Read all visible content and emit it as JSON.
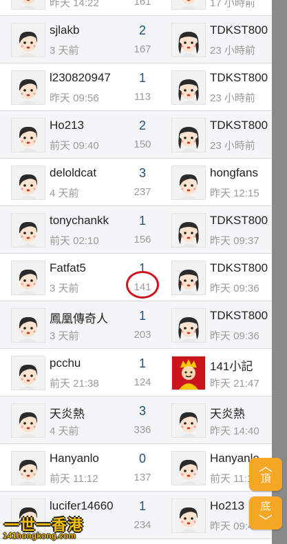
{
  "rows": [
    {
      "poster": "",
      "time": "昨天 14:22",
      "replies": "",
      "views": "161",
      "last_user": "",
      "last_time": "17 小時前",
      "last_avatar": "boy"
    },
    {
      "poster": "sjlakb",
      "time": "3 天前",
      "replies": "2",
      "views": "167",
      "last_user": "TDKST800",
      "last_time": "23 小時前",
      "last_avatar": "girl"
    },
    {
      "poster": "l230820947",
      "time": "昨天 09:56",
      "replies": "1",
      "views": "113",
      "last_user": "TDKST800",
      "last_time": "23 小時前",
      "last_avatar": "girl"
    },
    {
      "poster": "Ho213",
      "time": "前天 09:40",
      "replies": "2",
      "views": "150",
      "last_user": "TDKST800",
      "last_time": "23 小時前",
      "last_avatar": "girl"
    },
    {
      "poster": "deloldcat",
      "time": "4 天前",
      "replies": "3",
      "views": "237",
      "last_user": "hongfans",
      "last_time": "昨天 12:15",
      "last_avatar": "boy"
    },
    {
      "poster": "tonychankk",
      "time": "前天 02:10",
      "replies": "1",
      "views": "156",
      "last_user": "TDKST800",
      "last_time": "昨天 09:37",
      "last_avatar": "girl"
    },
    {
      "poster": "Fatfat5",
      "time": "3 天前",
      "replies": "1",
      "views": "141",
      "last_user": "TDKST800",
      "last_time": "昨天 09:36",
      "last_avatar": "girl"
    },
    {
      "poster": "鳳凰傳奇人",
      "time": "3 天前",
      "replies": "1",
      "views": "203",
      "last_user": "TDKST800",
      "last_time": "昨天 09:36",
      "last_avatar": "girl"
    },
    {
      "poster": "pcchu",
      "time": "前天 21:38",
      "replies": "1",
      "views": "124",
      "last_user": "141小記",
      "last_time": "昨天 21:47",
      "last_avatar": "king"
    },
    {
      "poster": "天炎熱",
      "time": "4 天前",
      "replies": "3",
      "views": "336",
      "last_user": "天炎熱",
      "last_time": "昨天 14:40",
      "last_avatar": "boy"
    },
    {
      "poster": "Hanyanlo",
      "time": "前天 11:12",
      "replies": "0",
      "views": "137",
      "last_user": "Hanyanlo",
      "last_time": "前天 11:12",
      "last_avatar": "boy"
    },
    {
      "poster": "lucifer14660",
      "time": "",
      "replies": "1",
      "views": "234",
      "last_user": "Ho213",
      "last_time": "昨天 09:4",
      "last_avatar": "boy"
    }
  ],
  "nav": {
    "top_label": "頂",
    "bottom_label": "底"
  },
  "watermark": {
    "line1": "一世一香港",
    "line2": "141hongkong.com"
  },
  "colors": {
    "highlight_circle": "#d0121b",
    "nav_button": "#f5a623"
  }
}
